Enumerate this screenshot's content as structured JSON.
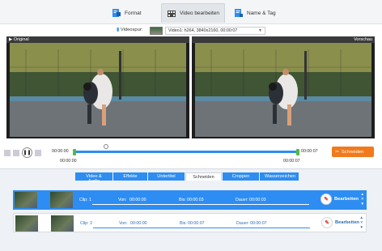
{
  "tabs": [
    {
      "label": "Format"
    },
    {
      "label": "Video bearbeiten"
    },
    {
      "label": "Name & Tag"
    }
  ],
  "track": {
    "label": "Videospur:",
    "value": "Video1: h264, 3840x2160, 00:00:07"
  },
  "preview": {
    "left_title": "Original",
    "right_title": "Vorschau"
  },
  "controls": {
    "play_icon": "pause-icon",
    "time_start": "00:00:00",
    "time_start_below": "00:00:00",
    "time_end": "00:00:07",
    "time_end_below": "00:00:07",
    "cut_label": "Schneiden",
    "accent": "#2d8df2",
    "cut_color": "#f07a1c"
  },
  "editor_tabs": [
    {
      "label": "Video & Audio"
    },
    {
      "label": "Effekte"
    },
    {
      "label": "Untertitel"
    },
    {
      "label": "Schneiden"
    },
    {
      "label": "Croppen"
    },
    {
      "label": "Wasserzeichen"
    }
  ],
  "clips": [
    {
      "clip": "Clip: 1",
      "from_label": "Von:",
      "from": "00:00:00",
      "to_label": "Bis:",
      "to": "00:00:03",
      "dur_label": "Dauer:",
      "dur": "00:00:03",
      "edit": "Bearbeiten"
    },
    {
      "clip": "Clip: 2",
      "from_label": "Von:",
      "from": "00:00:00",
      "to_label": "Bis:",
      "to": "00:00:07",
      "dur_label": "Dauer:",
      "dur": "00:00:07",
      "edit": "Bearbeiten"
    }
  ]
}
